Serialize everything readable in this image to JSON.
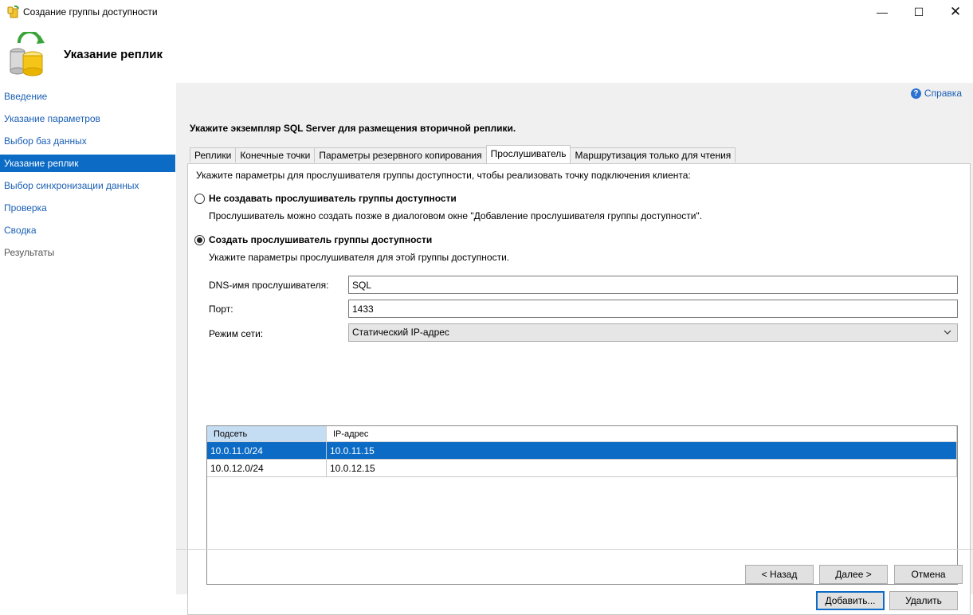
{
  "window": {
    "title": "Создание группы доступности",
    "minimize": "—",
    "maximize": "☐",
    "close": "✕"
  },
  "header": {
    "title": "Указание реплик"
  },
  "sidebar": {
    "items": [
      {
        "label": "Введение",
        "state": "link"
      },
      {
        "label": "Указание параметров",
        "state": "link"
      },
      {
        "label": "Выбор баз данных",
        "state": "link"
      },
      {
        "label": "Указание реплик",
        "state": "active"
      },
      {
        "label": "Выбор синхронизации данных",
        "state": "link"
      },
      {
        "label": "Проверка",
        "state": "link"
      },
      {
        "label": "Сводка",
        "state": "link"
      },
      {
        "label": "Результаты",
        "state": "disabled"
      }
    ]
  },
  "main": {
    "help_label": "Справка",
    "instruction": "Укажите экземпляр SQL Server для размещения вторичной реплики.",
    "tabs": [
      {
        "label": "Реплики"
      },
      {
        "label": "Конечные точки"
      },
      {
        "label": "Параметры резервного копирования"
      },
      {
        "label": "Прослушиватель",
        "active": true
      },
      {
        "label": "Маршрутизация только для чтения"
      }
    ],
    "listener": {
      "intro": "Укажите параметры для прослушивателя группы доступности, чтобы реализовать точку подключения клиента:",
      "option_no": {
        "label": "Не создавать прослушиватель группы доступности",
        "description": "Прослушиватель можно создать позже в диалоговом окне \"Добавление прослушивателя группы доступности\".",
        "checked": false
      },
      "option_yes": {
        "label": "Создать прослушиватель группы доступности",
        "description": "Укажите параметры прослушивателя для этой группы доступности.",
        "checked": true
      },
      "dns_label": "DNS-имя прослушивателя:",
      "dns_value": "SQL",
      "port_label": "Порт:",
      "port_value": "1433",
      "network_mode_label": "Режим сети:",
      "network_mode_value": "Статический IP-адрес",
      "grid": {
        "columns": [
          "Подсеть",
          "IP-адрес"
        ],
        "rows": [
          {
            "subnet": "10.0.11.0/24",
            "ip": "10.0.11.15",
            "selected": true
          },
          {
            "subnet": "10.0.12.0/24",
            "ip": "10.0.12.15",
            "selected": false
          }
        ]
      },
      "add_button": "Добавить...",
      "remove_button": "Удалить"
    }
  },
  "footer": {
    "back_button": "< Назад",
    "next_button": "Далее >",
    "cancel_button": "Отмена"
  },
  "colors": {
    "accent": "#0b6bc5",
    "link": "#1a5fb4",
    "panel_bg": "#f0f0f0"
  }
}
